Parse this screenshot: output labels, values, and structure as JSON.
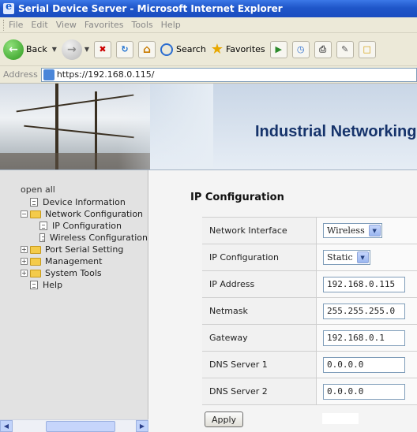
{
  "window": {
    "title": "Serial Device Server - Microsoft Internet Explorer"
  },
  "menu": [
    "File",
    "Edit",
    "View",
    "Favorites",
    "Tools",
    "Help"
  ],
  "toolbar": {
    "back": "Back",
    "search": "Search",
    "favorites": "Favorites"
  },
  "address": {
    "label": "Address",
    "url": "https://192.168.0.115/"
  },
  "banner": {
    "title": "Industrial Networking"
  },
  "sidebar": {
    "open_all": "open all",
    "items": {
      "device_information": "Device Information",
      "network_configuration": "Network Configuration",
      "ip_configuration": "IP Configuration",
      "wireless_configuration": "Wireless Configuration",
      "port_serial_setting": "Port Serial Setting",
      "management": "Management",
      "system_tools": "System Tools",
      "help": "Help"
    }
  },
  "main": {
    "heading": "IP Configuration",
    "fields": {
      "network_interface": {
        "label": "Network Interface",
        "value": "Wireless"
      },
      "ip_configuration": {
        "label": "IP Configuration",
        "value": "Static"
      },
      "ip_address": {
        "label": "IP Address",
        "value": "192.168.0.115"
      },
      "netmask": {
        "label": "Netmask",
        "value": "255.255.255.0"
      },
      "gateway": {
        "label": "Gateway",
        "value": "192.168.0.1"
      },
      "dns1": {
        "label": "DNS Server 1",
        "value": "0.0.0.0"
      },
      "dns2": {
        "label": "DNS Server 2",
        "value": "0.0.0.0"
      }
    },
    "apply_label": "Apply"
  }
}
